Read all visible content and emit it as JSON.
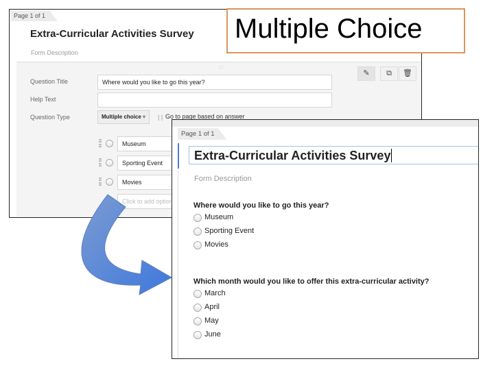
{
  "slide_title": "Multiple Choice",
  "colors": {
    "title_border": "#d9965a",
    "arrow": "#4f7ed0",
    "accent": "#4a7cc9"
  },
  "editor": {
    "page_tab": "Page 1 of 1",
    "form_title": "Extra-Curricular Activities Survey",
    "form_description": "Form Description",
    "question_title_label": "Question Title",
    "question_title_value": "Where would you like to go this year?",
    "help_text_label": "Help Text",
    "help_text_value": "",
    "question_type_label": "Question Type",
    "question_type_value": "Multiple choice",
    "go_to_page_label": "Go to page based on answer",
    "options": [
      "Museum",
      "Sporting Event",
      "Movies"
    ],
    "add_option_placeholder": "Click to add option",
    "tool_icons": [
      "pencil-icon",
      "duplicate-icon",
      "trash-icon"
    ]
  },
  "preview": {
    "page_tab": "Page 1 of 1",
    "form_title": "Extra-Curricular Activities Survey",
    "form_description": "Form Description",
    "questions": [
      {
        "text": "Where would you like to go this year?",
        "options": [
          "Museum",
          "Sporting Event",
          "Movies"
        ]
      },
      {
        "text": "Which month would you like to offer this extra-curricular activity?",
        "options": [
          "March",
          "April",
          "May",
          "June"
        ]
      }
    ]
  }
}
